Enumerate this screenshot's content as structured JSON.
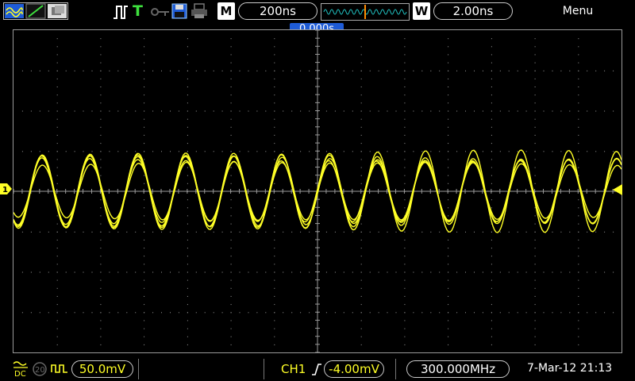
{
  "top": {
    "timebase": "200ns",
    "window_label": "W",
    "window_value": "2.00ns",
    "main_label": "M",
    "menu": "Menu",
    "trigger_ready": "T"
  },
  "trigger_position": "0.000s",
  "channel_marker": "1",
  "bottom": {
    "coupling": "DC",
    "probe": "20",
    "ch1_scale": "50.0mV",
    "trigger_source": "CH1",
    "trigger_level": "-4.00mV",
    "frequency": "300.000MHz",
    "datetime": "7-Mar-12 21:13"
  },
  "colors": {
    "trace": "#ffff26",
    "grid": "#9a9a9a",
    "trigger_marker": "#1e5bd6"
  },
  "waveform": {
    "cycles": 12.7,
    "amplitude_divisions": 0.95,
    "overlay_count": 5
  }
}
